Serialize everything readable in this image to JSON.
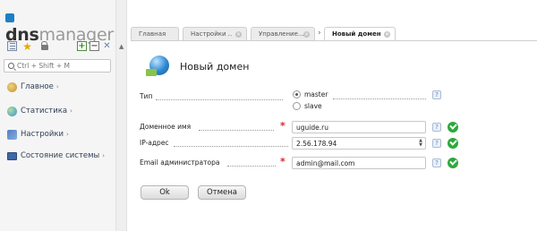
{
  "app": {
    "logo_prefix": "dns",
    "logo_suffix": "manager"
  },
  "sidebar": {
    "search_placeholder": "Ctrl + Shift + M",
    "items": [
      {
        "label": "Главное",
        "icon": "home-icon"
      },
      {
        "label": "Статистика",
        "icon": "globe-icon"
      },
      {
        "label": "Настройки",
        "icon": "tools-icon"
      },
      {
        "label": "Состояние системы",
        "icon": "monitor-icon"
      }
    ],
    "arrow": "›"
  },
  "tabs": [
    {
      "label": "Главная",
      "closable": false,
      "active": false
    },
    {
      "label": "Настройки ..",
      "closable": true,
      "active": false
    },
    {
      "label": "Управление...",
      "closable": true,
      "active": false
    },
    {
      "label": "Новый домен",
      "closable": true,
      "active": true
    }
  ],
  "tab_separator": "›",
  "form": {
    "title": "Новый домен",
    "type_label": "Тип",
    "type_options": [
      {
        "label": "master",
        "selected": true
      },
      {
        "label": "slave",
        "selected": false
      }
    ],
    "domain_label": "Доменное имя",
    "domain_value": "uguide.ru",
    "ip_label": "IP-адрес",
    "ip_value": "2.56.178.94",
    "email_label": "Email администратора",
    "email_value": "admin@mail.com",
    "required_mark": "*",
    "help_mark": "?",
    "ok_label": "Ok",
    "cancel_label": "Отмена"
  },
  "colors": {
    "accent": "#1f7fc4",
    "valid": "#2ea83c",
    "required": "#d9262c"
  }
}
